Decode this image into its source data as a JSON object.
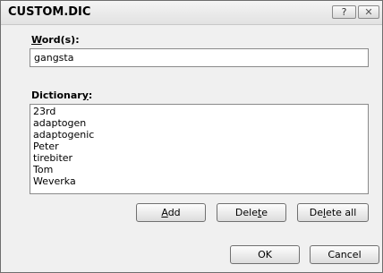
{
  "window": {
    "title": "CUSTOM.DIC",
    "help_glyph": "?",
    "close_glyph": "✕"
  },
  "word": {
    "label_mnemonic": "W",
    "label_rest": "ord(s):",
    "value": "gangsta"
  },
  "dictionary": {
    "label_before": "Dictionar",
    "label_mnemonic": "y",
    "label_after": ":",
    "items": [
      "23rd",
      "adaptogen",
      "adaptogenic",
      "Peter",
      "tirebiter",
      "Tom",
      "Weverka"
    ]
  },
  "buttons": {
    "add": {
      "mnemonic": "A",
      "rest": "dd"
    },
    "delete": {
      "before": "Dele",
      "mnemonic": "t",
      "after": "e"
    },
    "delete_all": {
      "before": "De",
      "mnemonic": "l",
      "after": "ete all"
    },
    "ok": "OK",
    "cancel": "Cancel"
  }
}
